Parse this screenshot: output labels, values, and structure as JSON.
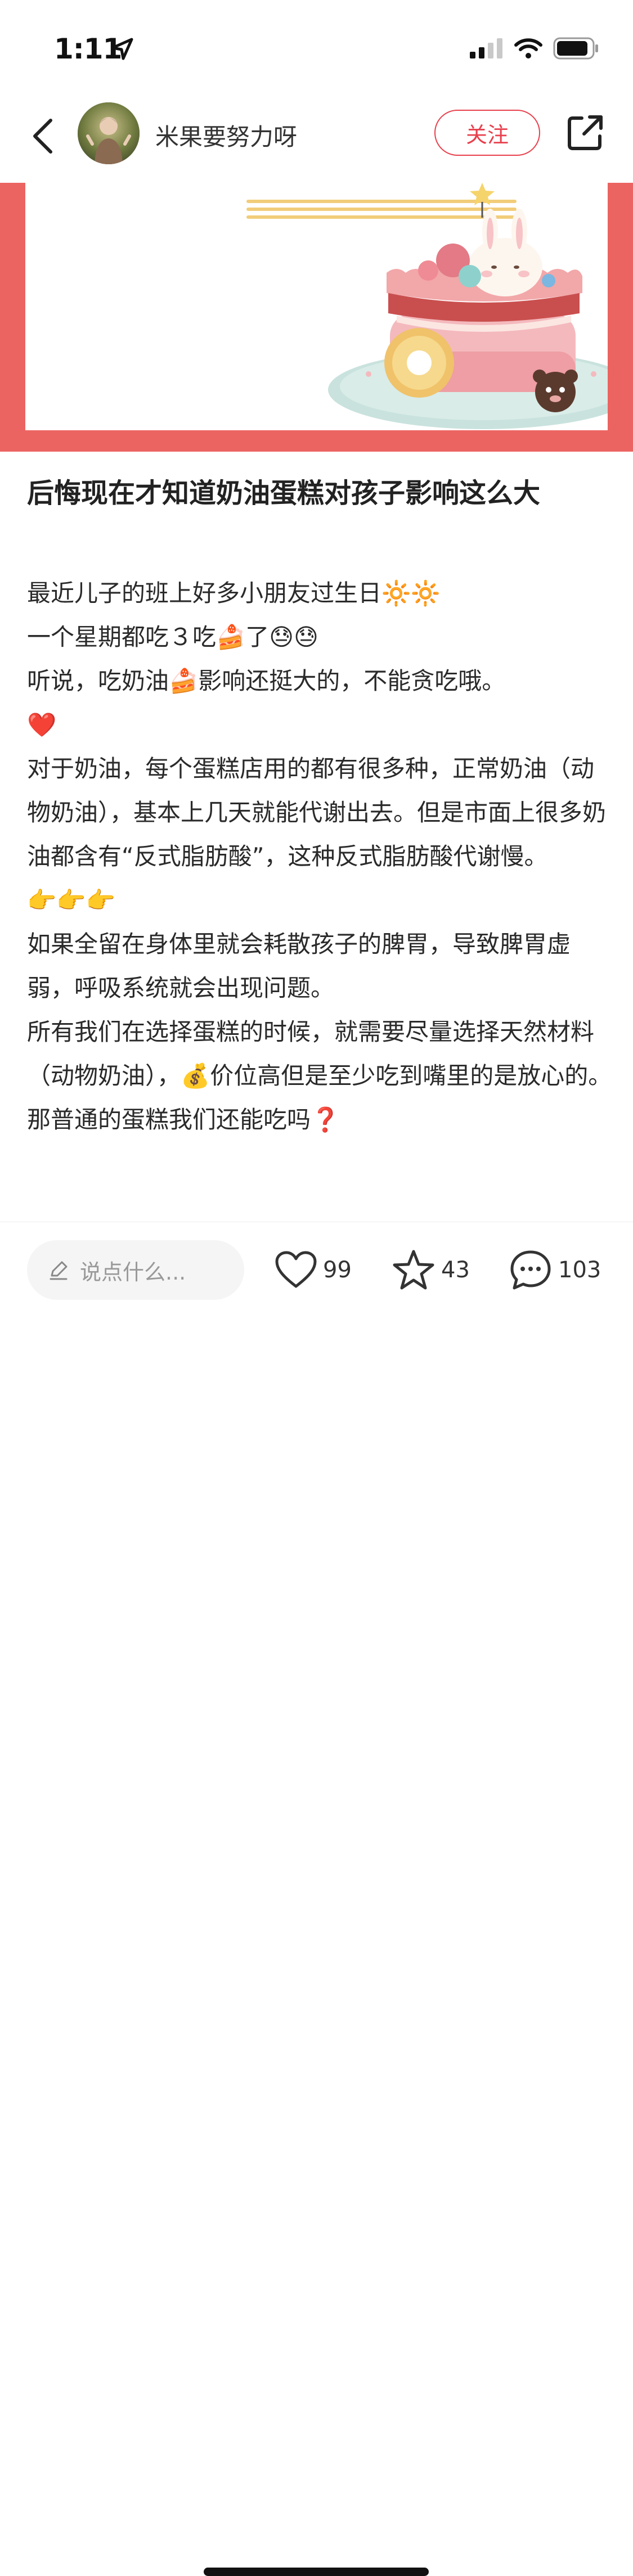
{
  "status_bar": {
    "time": "1:11"
  },
  "header": {
    "author_name": "米果要努力呀",
    "follow_label": "关注"
  },
  "post": {
    "title": "后悔现在才知道奶油蛋糕对孩子影响这么大",
    "lines": [
      "最近儿子的班上好多小朋友过生日🔆🔆",
      "一个星期都吃３吃🍰了😓😓",
      "听说，吃奶油🍰影响还挺大的，不能贪吃哦。",
      "❤️",
      "对于奶油，每个蛋糕店用的都有很多种，正常奶油（动物奶油），基本上几天就能代谢出去。但是市面上很多奶油都含有“反式脂肪酸”，这种反式脂肪酸代谢慢。",
      "👉👉👉",
      "如果全留在身体里就会耗散孩子的脾胃，导致脾胃虚弱，呼吸系统就会出现问题。",
      "所有我们在选择蛋糕的时候，就需要尽量选择天然材料（动物奶油），💰价位高但是至少吃到嘴里的是放心的。",
      "那普通的蛋糕我们还能吃吗❓"
    ]
  },
  "bottom_bar": {
    "comment_placeholder": "说点什么...",
    "like_count": "99",
    "star_count": "43",
    "comment_count": "103"
  },
  "colors": {
    "accent": "#e8404d",
    "banner_frame": "#ec6461"
  },
  "icons": {
    "back": "chevron-left-icon",
    "share": "share-icon",
    "location": "location-arrow-icon",
    "signal": "cellular-signal-icon",
    "wifi": "wifi-icon",
    "battery": "battery-icon",
    "like": "heart-icon",
    "star": "star-icon",
    "comment": "comment-bubble-icon",
    "pen": "pen-icon"
  }
}
